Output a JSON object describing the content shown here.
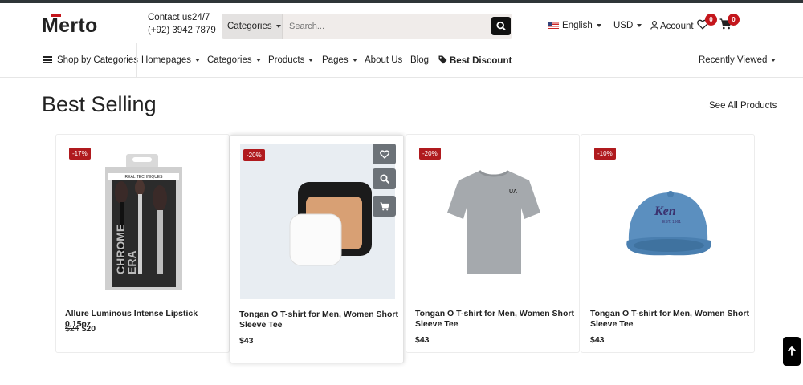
{
  "header": {
    "logo": "Merto",
    "contact_line1": "Contact us24/7",
    "contact_line2": "(+92) 3942 7879",
    "search_category": "Categories",
    "search_placeholder": "Search...",
    "language": "English",
    "currency": "USD",
    "account": "Account",
    "wishlist_count": "0",
    "cart_count": "0"
  },
  "nav": {
    "shop_by": "Shop by Categories",
    "items": [
      "Homepages",
      "Categories",
      "Products",
      "Pages",
      "About Us",
      "Blog"
    ],
    "best_discount": "Best Discount",
    "recently_viewed": "Recently Viewed"
  },
  "section": {
    "title": "Best Selling",
    "see_all": "See All Products"
  },
  "products": [
    {
      "discount": "-17%",
      "name": "Allure Luminous Intense Lipstick 0.15oz",
      "old_price": "$24",
      "price": "$20",
      "image": "makeup-brush-set"
    },
    {
      "discount": "-20%",
      "name": "Tongan O T-shirt for Men, Women Short Sleeve Tee",
      "old_price": "",
      "price": "$43",
      "image": "powder-compact"
    },
    {
      "discount": "-20%",
      "name": "Tongan O T-shirt for Men, Women Short Sleeve Tee",
      "old_price": "",
      "price": "$43",
      "image": "grey-tshirt"
    },
    {
      "discount": "-10%",
      "name": "Tongan O T-shirt for Men, Women Short Sleeve Tee",
      "old_price": "",
      "price": "$43",
      "image": "blue-cap"
    }
  ],
  "colors": {
    "accent": "#c4161c",
    "discount_badge": "#b01a1e",
    "action_button": "#6c7278"
  },
  "icons": {
    "search": "search-icon",
    "user": "user-icon",
    "wishlist": "heart-icon",
    "cart": "cart-icon",
    "tag": "tag-icon",
    "back_to_top": "arrow-up-icon"
  }
}
